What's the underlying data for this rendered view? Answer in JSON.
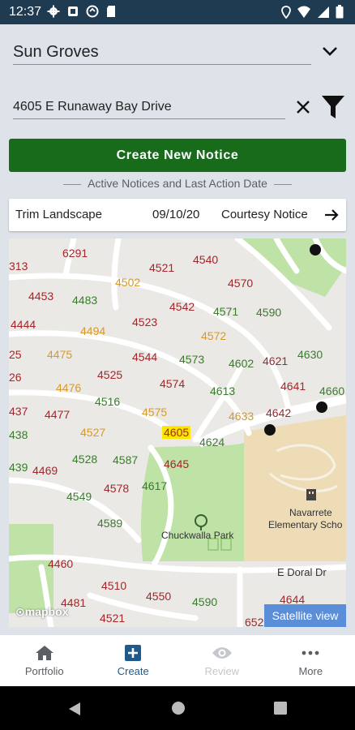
{
  "status_bar": {
    "time": "12:37"
  },
  "community": {
    "selected": "Sun Groves"
  },
  "address": {
    "value": "4605 E Runaway Bay Drive"
  },
  "create_button": {
    "label": "Create New Notice"
  },
  "section_caption": "Active Notices and Last Action Date",
  "notice": {
    "type": "Trim Landscape",
    "date": "09/10/20",
    "status": "Courtesy Notice"
  },
  "map": {
    "lots": [
      {
        "id": "l6291",
        "text": "6291",
        "color": "red"
      },
      {
        "id": "l313",
        "text": "313",
        "color": "red"
      },
      {
        "id": "l4521a",
        "text": "4521",
        "color": "red"
      },
      {
        "id": "l4540",
        "text": "4540",
        "color": "red"
      },
      {
        "id": "l4502",
        "text": "4502",
        "color": "orange"
      },
      {
        "id": "l4570",
        "text": "4570",
        "color": "red"
      },
      {
        "id": "l4453",
        "text": "4453",
        "color": "red"
      },
      {
        "id": "l4483",
        "text": "4483",
        "color": "green"
      },
      {
        "id": "l4542",
        "text": "4542",
        "color": "red"
      },
      {
        "id": "l4571",
        "text": "4571",
        "color": "green"
      },
      {
        "id": "l4590a",
        "text": "4590",
        "color": "green"
      },
      {
        "id": "l4444",
        "text": "4444",
        "color": "red"
      },
      {
        "id": "l4494",
        "text": "4494",
        "color": "orange"
      },
      {
        "id": "l4523",
        "text": "4523",
        "color": "red"
      },
      {
        "id": "l4572",
        "text": "4572",
        "color": "orange"
      },
      {
        "id": "l25",
        "text": "25",
        "color": "red"
      },
      {
        "id": "l4475",
        "text": "4475",
        "color": "orange"
      },
      {
        "id": "l4544",
        "text": "4544",
        "color": "red"
      },
      {
        "id": "l4573",
        "text": "4573",
        "color": "green"
      },
      {
        "id": "l4602",
        "text": "4602",
        "color": "green"
      },
      {
        "id": "l4621",
        "text": "4621",
        "color": "red"
      },
      {
        "id": "l4630",
        "text": "4630",
        "color": "green"
      },
      {
        "id": "l26",
        "text": "26",
        "color": "red"
      },
      {
        "id": "l4525",
        "text": "4525",
        "color": "red"
      },
      {
        "id": "l4476",
        "text": "4476",
        "color": "orange"
      },
      {
        "id": "l4574",
        "text": "4574",
        "color": "red"
      },
      {
        "id": "l4641",
        "text": "4641",
        "color": "red"
      },
      {
        "id": "l4660",
        "text": "4660",
        "color": "green"
      },
      {
        "id": "l4613",
        "text": "4613",
        "color": "green"
      },
      {
        "id": "l4516",
        "text": "4516",
        "color": "green"
      },
      {
        "id": "l437",
        "text": "437",
        "color": "red"
      },
      {
        "id": "l4477",
        "text": "4477",
        "color": "red"
      },
      {
        "id": "l4575",
        "text": "4575",
        "color": "orange"
      },
      {
        "id": "l4633",
        "text": "4633",
        "color": "orange"
      },
      {
        "id": "l4642",
        "text": "4642",
        "color": "red"
      },
      {
        "id": "l438",
        "text": "438",
        "color": "green"
      },
      {
        "id": "l4527",
        "text": "4527",
        "color": "orange"
      },
      {
        "id": "l4605",
        "text": "4605",
        "color": "selected"
      },
      {
        "id": "l4624",
        "text": "4624",
        "color": "green"
      },
      {
        "id": "l439",
        "text": "439",
        "color": "green"
      },
      {
        "id": "l4469",
        "text": "4469",
        "color": "red"
      },
      {
        "id": "l4528",
        "text": "4528",
        "color": "green"
      },
      {
        "id": "l4587",
        "text": "4587",
        "color": "green"
      },
      {
        "id": "l4645",
        "text": "4645",
        "color": "red"
      },
      {
        "id": "l4549",
        "text": "4549",
        "color": "green"
      },
      {
        "id": "l4578",
        "text": "4578",
        "color": "red"
      },
      {
        "id": "l4617",
        "text": "4617",
        "color": "green"
      },
      {
        "id": "l4589",
        "text": "4589",
        "color": "green"
      },
      {
        "id": "l4460",
        "text": "4460",
        "color": "red"
      },
      {
        "id": "l4510",
        "text": "4510",
        "color": "red"
      },
      {
        "id": "l4550",
        "text": "4550",
        "color": "red"
      },
      {
        "id": "l4481",
        "text": "4481",
        "color": "red"
      },
      {
        "id": "l4590b",
        "text": "4590",
        "color": "green"
      },
      {
        "id": "l4644",
        "text": "4644",
        "color": "red"
      },
      {
        "id": "l4521b",
        "text": "4521",
        "color": "red"
      },
      {
        "id": "l652",
        "text": "652",
        "color": "red"
      }
    ],
    "park_label": "Chuckwalla Park",
    "school_label_1": "Navarrete",
    "school_label_2": "Elementary Scho",
    "street_label": "E Doral Dr",
    "attribution": "mapbox",
    "satellite_label": "Satellite view"
  },
  "bottom_nav": [
    {
      "label": "Portfolio",
      "icon": "home-icon"
    },
    {
      "label": "Create",
      "icon": "add-box-icon"
    },
    {
      "label": "Review",
      "icon": "eye-icon"
    },
    {
      "label": "More",
      "icon": "more-icon"
    }
  ],
  "colors": {
    "primary_green": "#176b1b",
    "status_bar": "#1f3b52",
    "selected_lot": "#ffe600",
    "satellite_btn": "#5a8ed8"
  }
}
